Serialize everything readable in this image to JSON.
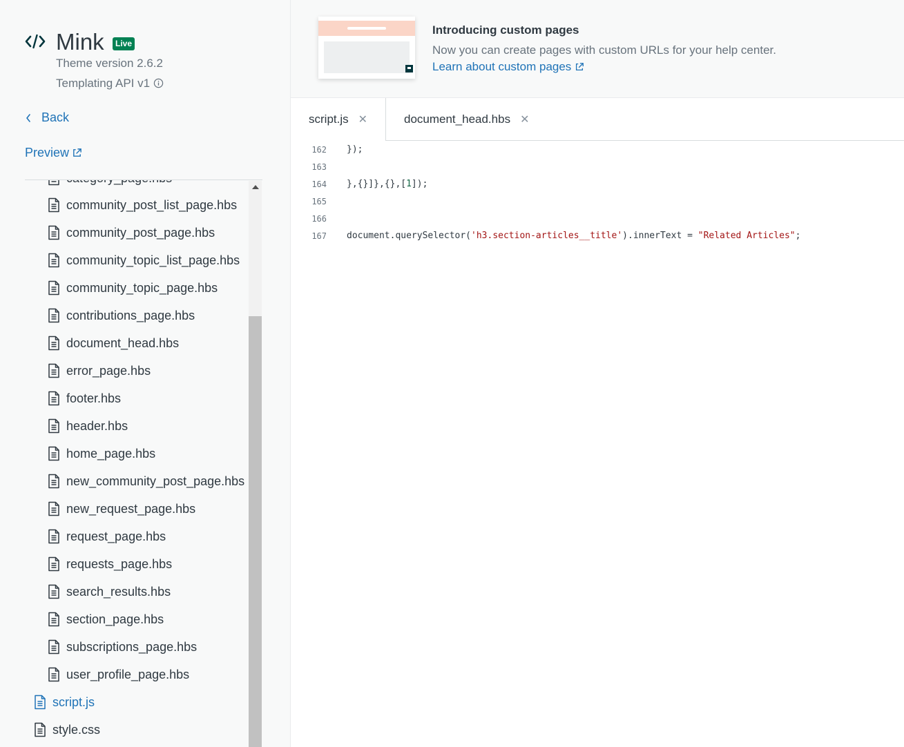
{
  "theme": {
    "name": "Mink",
    "status_badge": "Live",
    "version": "Theme version 2.6.2",
    "api": "Templating API v1"
  },
  "nav": {
    "back": "Back",
    "preview": "Preview"
  },
  "files": {
    "partial_top": "category_page.hbs",
    "templates": [
      "community_post_list_page.hbs",
      "community_post_page.hbs",
      "community_topic_list_page.hbs",
      "community_topic_page.hbs",
      "contributions_page.hbs",
      "document_head.hbs",
      "error_page.hbs",
      "footer.hbs",
      "header.hbs",
      "home_page.hbs",
      "new_community_post_page.hbs",
      "new_request_page.hbs",
      "request_page.hbs",
      "requests_page.hbs",
      "search_results.hbs",
      "section_page.hbs",
      "subscriptions_page.hbs",
      "user_profile_page.hbs"
    ],
    "root": [
      "script.js",
      "style.css"
    ],
    "active": "script.js"
  },
  "banner": {
    "title": "Introducing custom pages",
    "description": "Now you can create pages with custom URLs for your help center.",
    "link": "Learn about custom pages"
  },
  "tabs": [
    {
      "label": "script.js",
      "active": true
    },
    {
      "label": "document_head.hbs",
      "active": false
    }
  ],
  "code": {
    "lines": [
      {
        "no": "162",
        "segments": [
          {
            "t": "});",
            "k": "plain"
          }
        ]
      },
      {
        "no": "163",
        "segments": []
      },
      {
        "no": "164",
        "segments": [
          {
            "t": "},{}]},{},[",
            "k": "plain"
          },
          {
            "t": "1",
            "k": "num"
          },
          {
            "t": "]);",
            "k": "plain"
          }
        ]
      },
      {
        "no": "165",
        "segments": []
      },
      {
        "no": "166",
        "segments": []
      },
      {
        "no": "167",
        "segments": [
          {
            "t": "document.querySelector(",
            "k": "plain"
          },
          {
            "t": "'h3.section-articles__title'",
            "k": "str"
          },
          {
            "t": ").innerText = ",
            "k": "plain"
          },
          {
            "t": "\"Related Articles\"",
            "k": "str"
          },
          {
            "t": ";",
            "k": "plain"
          }
        ]
      }
    ]
  },
  "colors": {
    "accent": "#1f73b7",
    "live_badge": "#038153",
    "banner_illustration": "#fbd5c7",
    "string_token": "#a31515",
    "number_token": "#116644"
  },
  "icons": {
    "theme": "code-icon",
    "info": "info-icon",
    "back": "chevron-left-icon",
    "external": "external-link-icon",
    "file": "file-document-icon",
    "close": "close-icon"
  }
}
